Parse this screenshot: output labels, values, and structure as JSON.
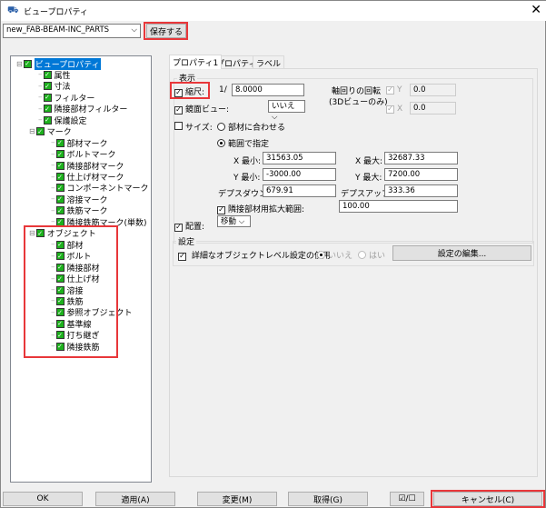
{
  "window": {
    "title": "ビュープロパティ",
    "close": "✕"
  },
  "toolbar": {
    "preset": "new_FAB-BEAM-INC_PARTS",
    "save": "保存する"
  },
  "tree": {
    "root": "ビュープロパティ",
    "items": [
      "属性",
      "寸法",
      "フィルター",
      "隣接部材フィルター",
      "保護設定"
    ],
    "mark": "マーク",
    "mark_items": [
      "部材マーク",
      "ボルトマーク",
      "隣接部材マーク",
      "仕上げ材マーク",
      "コンポーネントマーク",
      "溶接マーク",
      "鉄筋マーク",
      "隣接鉄筋マーク(単数)"
    ],
    "object": "オブジェクト",
    "object_items": [
      "部材",
      "ボルト",
      "隣接部材",
      "仕上げ材",
      "溶接",
      "鉄筋",
      "参照オブジェクト",
      "基準線",
      "打ち継ぎ",
      "隣接鉄筋"
    ]
  },
  "tabs": [
    "プロパティ1",
    "プロパティ2",
    "ラベル"
  ],
  "display": {
    "group": "表示",
    "scale_label": "縮尺:",
    "scale_prefix": "1/",
    "scale": "8.0000",
    "rotation_label": "軸回りの回転",
    "rotation_sub": "(3Dビューのみ)",
    "rot_y_label": "Y",
    "rot_y": "0.0",
    "rot_x_label": "X",
    "rot_x": "0.0",
    "mirror_label": "鏡面ビュー:",
    "mirror": "いいえ",
    "size_label": "サイズ:",
    "fit_label": "部材に合わせる",
    "range_label": "範囲で指定",
    "xmin_label": "X 最小:",
    "xmin": "31563.05",
    "xmax_label": "X 最大:",
    "xmax": "32687.33",
    "ymin_label": "Y 最小:",
    "ymin": "-3000.00",
    "ymax_label": "Y 最大:",
    "ymax": "7200.00",
    "depth_down_label": "デプスダウン:",
    "depth_down": "679.91",
    "depth_up_label": "デプスアップ:",
    "depth_up": "333.36",
    "adj_label": "隣接部材用拡大範囲:",
    "adj": "100.00",
    "place_label": "配置:",
    "place": "移動"
  },
  "settings": {
    "group": "設定",
    "detail_label": "詳細なオブジェクトレベル設定の使用",
    "no": "いいえ",
    "yes": "はい",
    "edit": "設定の編集..."
  },
  "footer": {
    "ok": "OK",
    "apply": "適用(A)",
    "modify": "変更(M)",
    "get": "取得(G)",
    "toggle": "☑/☐",
    "cancel": "キャンセル(C)"
  }
}
